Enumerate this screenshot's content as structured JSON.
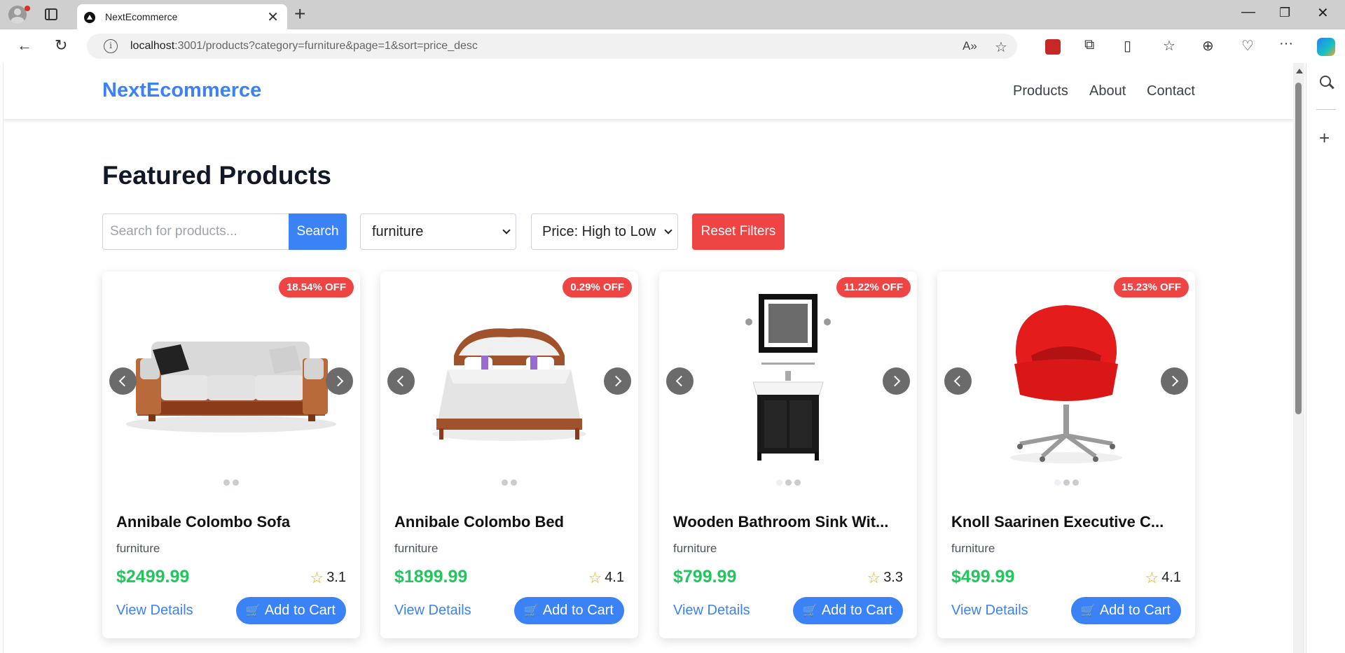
{
  "browser": {
    "tab_title": "NextEcommerce",
    "url_host": "localhost",
    "url_rest": ":3001/products?category=furniture&page=1&sort=price_desc"
  },
  "site": {
    "logo": "NextEcommerce",
    "nav": [
      "Products",
      "About",
      "Contact"
    ]
  },
  "page": {
    "title": "Featured Products",
    "search_placeholder": "Search for products...",
    "search_button": "Search",
    "category_selected": "furniture",
    "sort_selected": "Price: High to Low",
    "reset_button": "Reset Filters"
  },
  "products": [
    {
      "name": "Annibale Colombo Sofa",
      "category": "furniture",
      "price": "$2499.99",
      "rating": "3.1",
      "discount": "18.54% OFF",
      "details": "View Details",
      "cart": "Add to Cart",
      "image_count": 2,
      "active_image": 0
    },
    {
      "name": "Annibale Colombo Bed",
      "category": "furniture",
      "price": "$1899.99",
      "rating": "4.1",
      "discount": "0.29% OFF",
      "details": "View Details",
      "cart": "Add to Cart",
      "image_count": 2,
      "active_image": 0
    },
    {
      "name": "Wooden Bathroom Sink Wit...",
      "category": "furniture",
      "price": "$799.99",
      "rating": "3.3",
      "discount": "11.22% OFF",
      "details": "View Details",
      "cart": "Add to Cart",
      "image_count": 3,
      "active_image": 0
    },
    {
      "name": "Knoll Saarinen Executive C...",
      "category": "furniture",
      "price": "$499.99",
      "rating": "4.1",
      "discount": "15.23% OFF",
      "details": "View Details",
      "cart": "Add to Cart",
      "image_count": 3,
      "active_image": 0
    }
  ],
  "colors": {
    "brand": "#3b82f6",
    "price": "#22c55e",
    "badge": "#ef4444",
    "reset": "#ef4444",
    "star": "#eab308"
  }
}
